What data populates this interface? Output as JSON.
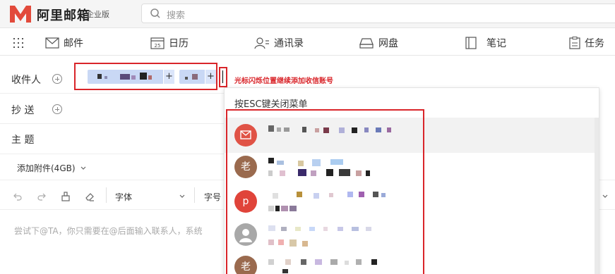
{
  "header": {
    "logo_text": "阿里邮箱",
    "edition": "企业版",
    "search_placeholder": "搜索"
  },
  "nav": {
    "mail": "邮件",
    "calendar": "日历",
    "calendar_day": "25",
    "contacts": "通讯录",
    "drive": "网盘",
    "notes": "笔记",
    "tasks": "任务"
  },
  "compose": {
    "to_label": "收件人",
    "cc_label": "抄 送",
    "subject_label": "主 题",
    "attach_label": "添加附件(4GB)",
    "annotation": "光标闪烁位置继续添加收信账号",
    "chip_plus": "+",
    "body_placeholder": "尝试下@TA，你只需要在@后面输入联系人，系统"
  },
  "toolbar": {
    "font_label": "字体",
    "size_label": "字号"
  },
  "dropdown": {
    "hint": "按ESC键关闭菜单",
    "contacts": [
      {
        "avatar_text": "",
        "color": "#e05346",
        "icon": "mail-icon"
      },
      {
        "avatar_text": "老",
        "color": "#9a6a4e",
        "icon": ""
      },
      {
        "avatar_text": "p",
        "color": "#e0443a",
        "icon": ""
      },
      {
        "avatar_text": "",
        "color": "#a8a8a8",
        "icon": "person-icon"
      },
      {
        "avatar_text": "老",
        "color": "#9a6a4e",
        "icon": ""
      }
    ]
  }
}
